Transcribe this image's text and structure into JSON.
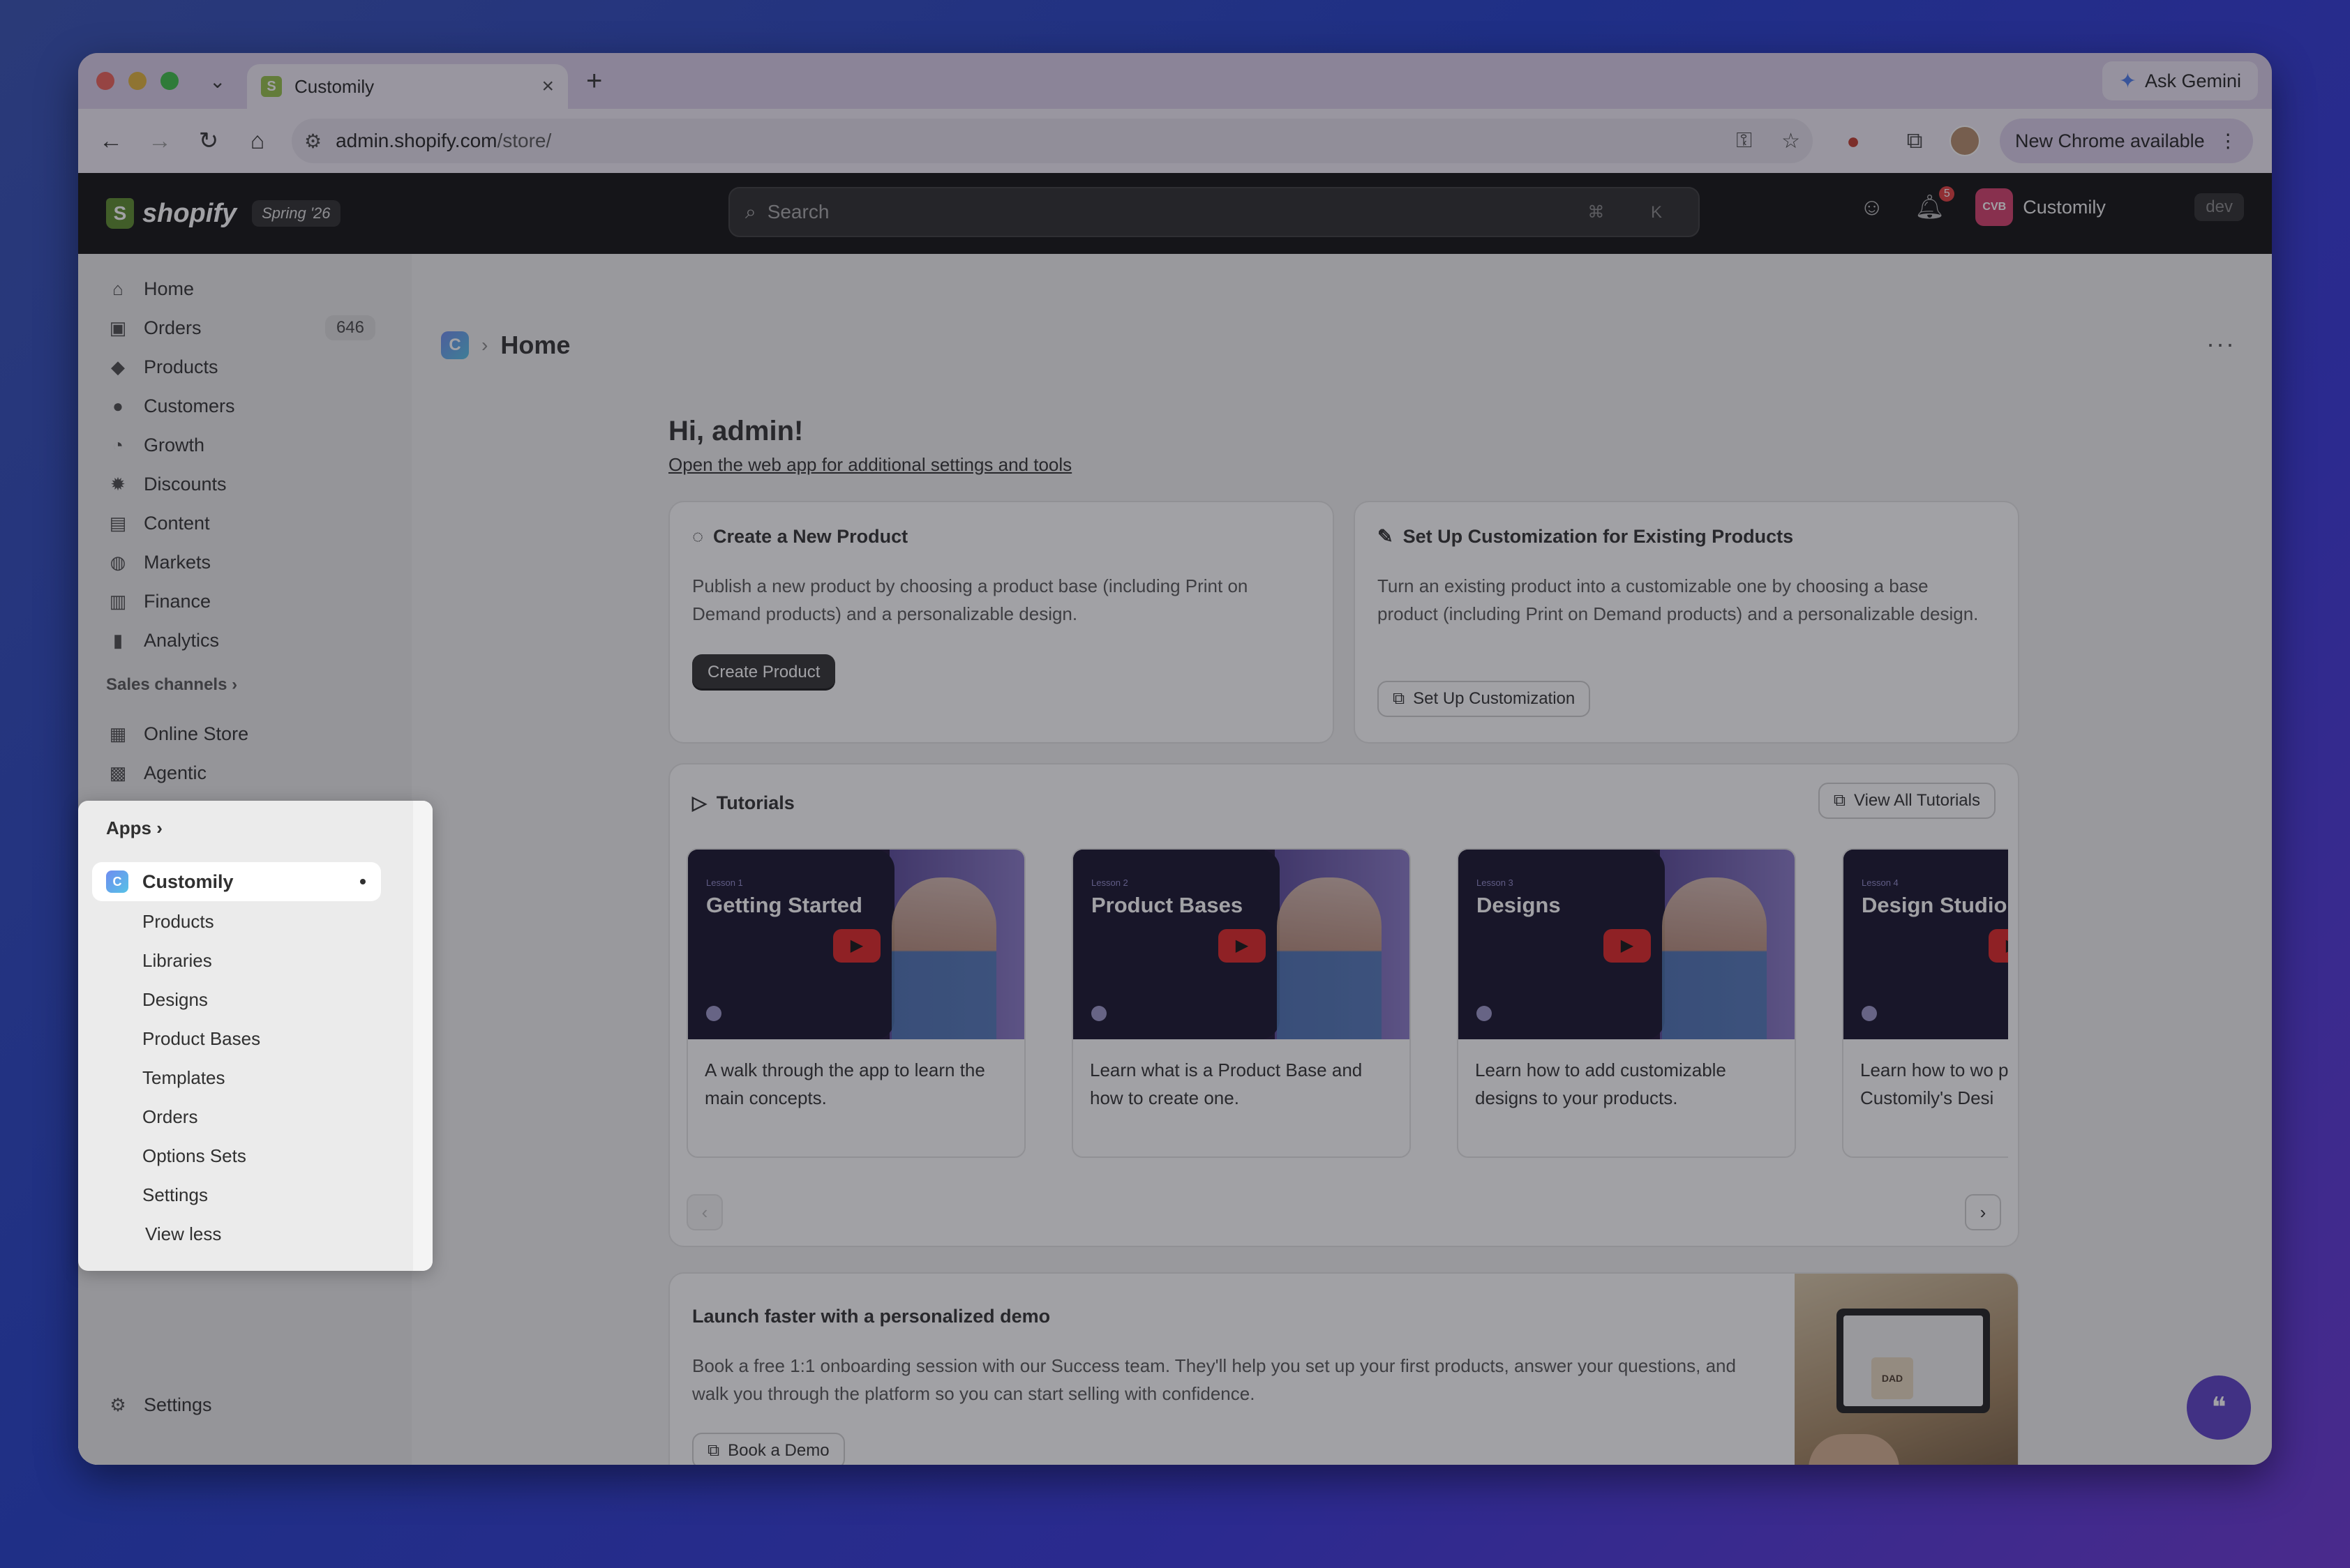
{
  "browser": {
    "tab_title": "Customily",
    "gemini_label": "Ask Gemini",
    "url_host": "admin.shopify.com",
    "url_path": "/store/",
    "new_chrome_label": "New Chrome available"
  },
  "shopify": {
    "logo_text": "shopify",
    "edition_badge": "Spring '26",
    "search_placeholder": "Search",
    "search_shortcut": "⌘ K",
    "notification_count": "5",
    "store_initials": "CVB",
    "store_name": "Customily",
    "env_badge": "dev"
  },
  "sidebar": {
    "items": [
      {
        "label": "Home",
        "icon": "home-icon"
      },
      {
        "label": "Orders",
        "icon": "orders-icon",
        "count": "646"
      },
      {
        "label": "Products",
        "icon": "tag-icon"
      },
      {
        "label": "Customers",
        "icon": "person-icon"
      },
      {
        "label": "Growth",
        "icon": "gauge-icon"
      },
      {
        "label": "Discounts",
        "icon": "discount-icon"
      },
      {
        "label": "Content",
        "icon": "content-icon"
      },
      {
        "label": "Markets",
        "icon": "globe-icon"
      },
      {
        "label": "Finance",
        "icon": "bank-icon"
      },
      {
        "label": "Analytics",
        "icon": "bar-chart-icon"
      }
    ],
    "sales_channels_label": "Sales channels",
    "channels": [
      {
        "label": "Online Store",
        "icon": "store-icon"
      },
      {
        "label": "Agentic",
        "icon": "agent-icon"
      }
    ],
    "apps_label": "Apps",
    "app_name": "Customily",
    "app_subitems": [
      "Products",
      "Libraries",
      "Designs",
      "Product Bases",
      "Templates",
      "Orders",
      "Options Sets",
      "Settings"
    ],
    "view_less": "View less",
    "settings_label": "Settings"
  },
  "page": {
    "breadcrumb_title": "Home",
    "greeting": "Hi, admin!",
    "web_app_link": "Open the web app for additional settings and tools",
    "create_card": {
      "title": "Create a New Product",
      "body": "Publish a new product by choosing a product base (including Print on Demand products) and a personalizable design.",
      "button": "Create Product"
    },
    "setup_card": {
      "title": "Set Up Customization for Existing Products",
      "body": "Turn an existing product into a customizable one by choosing a base product (including Print on Demand products) and a personalizable design.",
      "button": "Set Up Customization"
    },
    "tutorials": {
      "title": "Tutorials",
      "view_all": "View All Tutorials",
      "items": [
        {
          "lesson": "Lesson 1",
          "title": "Getting Started",
          "desc": "A walk through the app to learn the main concepts."
        },
        {
          "lesson": "Lesson 2",
          "title": "Product Bases",
          "desc": "Learn what is a Product Base and how to create one."
        },
        {
          "lesson": "Lesson 3",
          "title": "Designs",
          "desc": "Learn how to add customizable designs to your products."
        },
        {
          "lesson": "Lesson 4",
          "title": "Design Studio",
          "desc": "Learn how to wo personalization t Customily's Desi"
        }
      ]
    },
    "demo_card": {
      "title": "Launch faster with a personalized demo",
      "body": "Book a free 1:1 onboarding session with our Success team. They'll help you set up your first products, answer your questions, and walk you through the platform so you can start selling with confidence.",
      "button": "Book a Demo",
      "mug_text": "DAD"
    }
  },
  "colors": {
    "accent_dark": "#303030",
    "app_brand": "#5b3fc7",
    "youtube_red": "#e02424"
  }
}
